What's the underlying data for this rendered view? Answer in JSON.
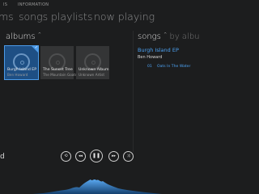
{
  "top_bar": {
    "items": [
      "IS",
      "INFORMATION"
    ]
  },
  "nav": {
    "tabs": [
      "ms",
      "songs",
      "playlists",
      "now playing"
    ]
  },
  "albums_section": {
    "title": "albums",
    "items": [
      {
        "title": "Burgh Island EP",
        "artist": "Ben Howard",
        "selected": true
      },
      {
        "title": "The Sunset Tree",
        "artist": "The Mountain Goats",
        "selected": false
      },
      {
        "title": "Unknown Album",
        "artist": "Unknown Artist",
        "selected": false
      }
    ]
  },
  "songs_section": {
    "title": "songs",
    "by_label": "by albu",
    "album": "Burgh Island EP",
    "artist": "Ben Howard",
    "track": {
      "number": "01",
      "title": "Oats In The Water"
    }
  },
  "player": {
    "now_playing_fragment": "d",
    "controls": [
      "repeat-icon",
      "previous-icon",
      "pause-icon",
      "next-icon",
      "shuffle-icon"
    ]
  },
  "colors": {
    "accent": "#4da3f4",
    "background": "#1c1d1e",
    "selected_tile": "#1e4f84"
  },
  "visualizer": {
    "fill_color": "#2f7fd4"
  }
}
